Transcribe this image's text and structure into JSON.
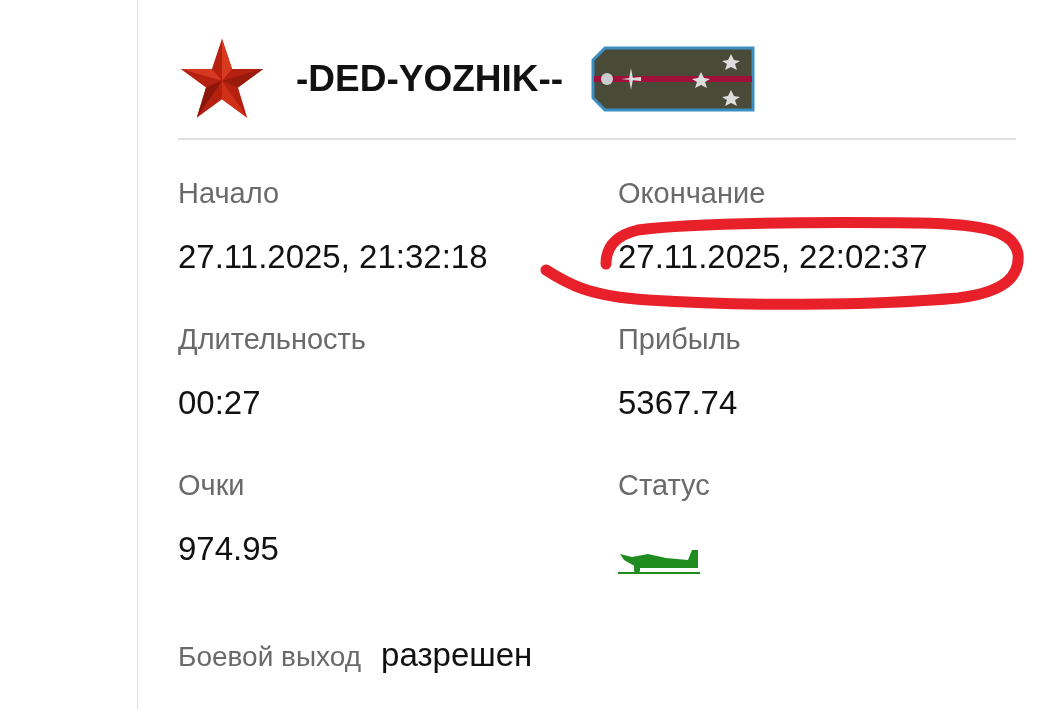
{
  "player": {
    "name": "-DED-YOZHIK--"
  },
  "fields": [
    {
      "label": "Начало",
      "kind": "text",
      "value": "27.11.2025, 21:32:18"
    },
    {
      "label": "Окончание",
      "kind": "text",
      "value": "27.11.2025, 22:02:37"
    },
    {
      "label": "Длительность",
      "kind": "text",
      "value": "00:27"
    },
    {
      "label": "Прибыль",
      "kind": "text",
      "value": "5367.74"
    },
    {
      "label": "Очки",
      "kind": "text",
      "value": "974.95"
    },
    {
      "label": "Статус",
      "kind": "plane",
      "color": "#1e8c1e"
    }
  ],
  "combat_exit": {
    "label": "Боевой выход",
    "value": "разрешен"
  }
}
